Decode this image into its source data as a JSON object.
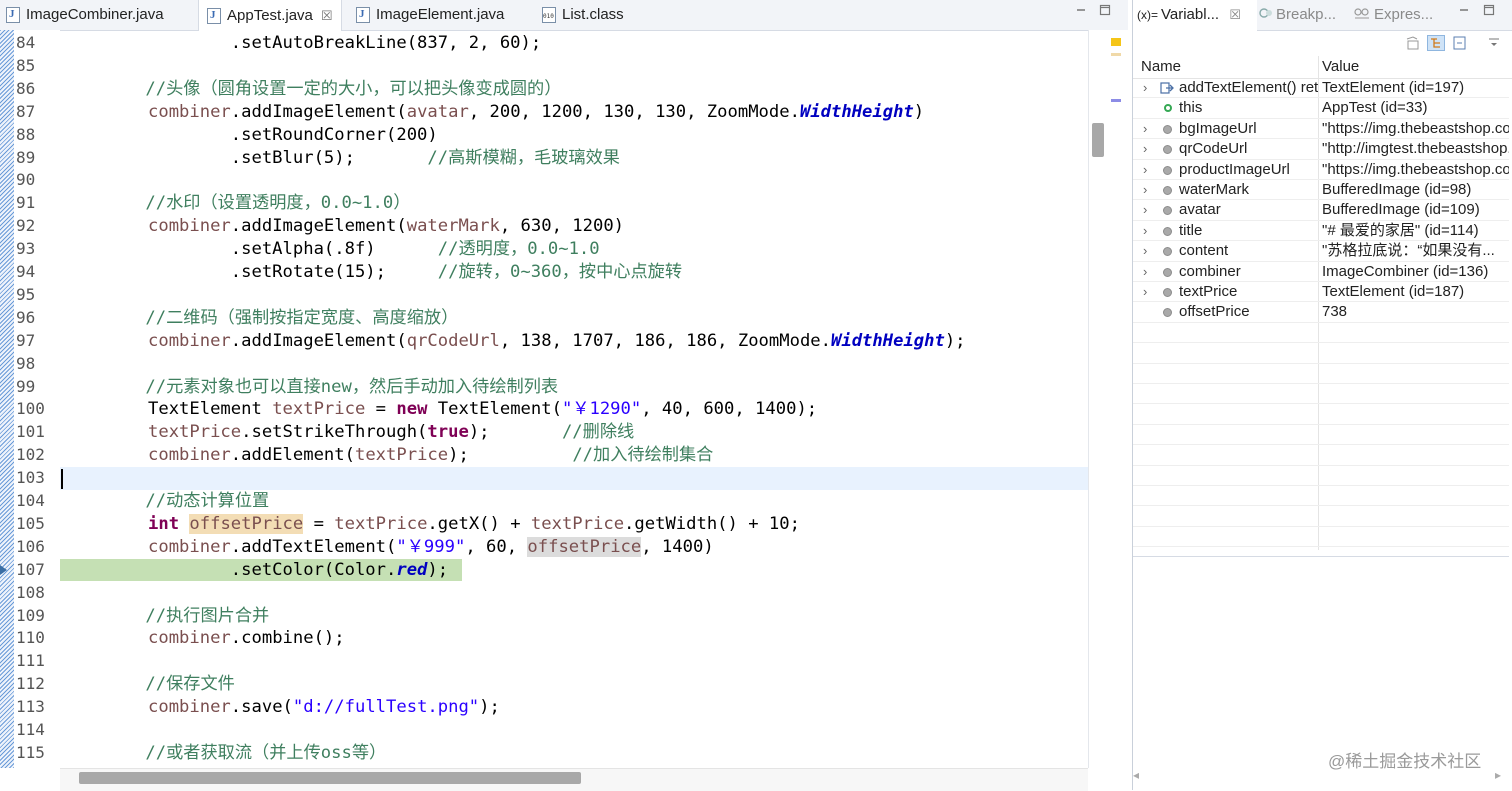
{
  "editor": {
    "tabs": [
      {
        "label": "ImageCombiner.java",
        "icon": "java-file-icon"
      },
      {
        "label": "AppTest.java",
        "icon": "java-file-icon",
        "active": true,
        "close": "☒"
      },
      {
        "label": "ImageElement.java",
        "icon": "java-file-icon"
      },
      {
        "label": "List.class",
        "icon": "class-file-icon"
      }
    ],
    "line_numbers": [
      "84",
      "85",
      "86",
      "87",
      "88",
      "89",
      "90",
      "91",
      "92",
      "93",
      "94",
      "95",
      "96",
      "97",
      "98",
      "99",
      "100",
      "101",
      "102",
      "103",
      "104",
      "105",
      "106",
      "107",
      "108",
      "109",
      "110",
      "111",
      "112",
      "113",
      "114",
      "115"
    ],
    "current_line": "103",
    "debug_line": "107",
    "colors": {
      "comment": "#3f7f5f",
      "field": "#7a4f4f",
      "keyword": "#7f0055",
      "string": "#2a00ff",
      "enum": "#0000c0",
      "current_line": "#e8f2fe",
      "debug_line": "#c5e0b4"
    },
    "code": {
      "l84": {
        "a": "        .setAutoBreakLine(837, 2, 60);"
      },
      "l86": {
        "c": "    //头像（圆角设置一定的大小，可以把头像变成圆的）"
      },
      "l87": {
        "f1": "combiner",
        "a": ".addImageElement(",
        "f2": "avatar",
        "b": ", 200, 1200, 130, 130, ZoomMode.",
        "e": "WidthHeight",
        "z": ")"
      },
      "l88": {
        "a": "        .setRoundCorner(200)"
      },
      "l89": {
        "a": "        .setBlur(5);       ",
        "c": "//高斯模糊，毛玻璃效果"
      },
      "l91": {
        "c": "    //水印（设置透明度，0.0~1.0）"
      },
      "l92": {
        "f1": "combiner",
        "a": ".addImageElement(",
        "f2": "waterMark",
        "b": ", 630, 1200)"
      },
      "l93": {
        "a": "        .setAlpha(.8f)      ",
        "c": "//透明度，0.0~1.0"
      },
      "l94": {
        "a": "        .setRotate(15);     ",
        "c": "//旋转，0~360，按中心点旋转"
      },
      "l96": {
        "c": "    //二维码（强制按指定宽度、高度缩放）"
      },
      "l97": {
        "f1": "combiner",
        "a": ".addImageElement(",
        "f2": "qrCodeUrl",
        "b": ", 138, 1707, 186, 186, ZoomMode.",
        "e": "WidthHeight",
        "z": ");"
      },
      "l99": {
        "c": "    //元素对象也可以直接new，然后手动加入待绘制列表"
      },
      "l100": {
        "a": "TextElement ",
        "f1": "textPrice",
        "b": " = ",
        "k": "new",
        "d": " TextElement(",
        "s": "\"￥1290\"",
        "z": ", 40, 600, 1400);"
      },
      "l101": {
        "f1": "textPrice",
        "a": ".setStrikeThrough(",
        "k": "true",
        "b": ");       ",
        "c": "//删除线"
      },
      "l102": {
        "f1": "combiner",
        "a": ".addElement(",
        "f2": "textPrice",
        "b": ");          ",
        "c": "//加入待绘制集合"
      },
      "l104": {
        "c": "    //动态计算位置"
      },
      "l105": {
        "k": "int",
        "h": "offsetPrice",
        "a": " = ",
        "f1": "textPrice",
        "b": ".getX() + ",
        "f2": "textPrice",
        "z": ".getWidth() + 10;"
      },
      "l106": {
        "f1": "combiner",
        "a": ".addTextElement(",
        "s": "\"￥999\"",
        "b": ", 60, ",
        "o": "offsetPrice",
        "z": ", 1400)"
      },
      "l107": {
        "a": "        .setColor(Color.",
        "e": "red",
        "z": ");"
      },
      "l109": {
        "c": "    //执行图片合并"
      },
      "l110": {
        "f1": "combiner",
        "a": ".combine();"
      },
      "l112": {
        "c": "    //保存文件"
      },
      "l113": {
        "f1": "combiner",
        "a": ".save(",
        "s": "\"d://fullTest.png\"",
        "z": ");"
      },
      "l115": {
        "c": "    //或者获取流（并上传oss等）"
      }
    }
  },
  "variables": {
    "tabs": [
      {
        "label": "Variabl...",
        "icon": "(x)=",
        "active": true,
        "close": "☒"
      },
      {
        "label": "Breakp...",
        "icon": "breakpoint-icon"
      },
      {
        "label": "Expres...",
        "icon": "expressions-icon"
      }
    ],
    "columns": {
      "name": "Name",
      "value": "Value"
    },
    "rows": [
      {
        "name": "addTextElement() returned",
        "value": "TextElement  (id=197)",
        "expand": "›",
        "icon": "return-value-icon"
      },
      {
        "name": "this",
        "value": "AppTest  (id=33)",
        "expand": "",
        "icon": "local-var-green-icon"
      },
      {
        "name": "bgImageUrl",
        "value": "\"https://img.thebeastshop.com\"",
        "expand": "›",
        "icon": "local-var-icon"
      },
      {
        "name": "qrCodeUrl",
        "value": "\"http://imgtest.thebeastshop.com\"",
        "expand": "›",
        "icon": "local-var-icon"
      },
      {
        "name": "productImageUrl",
        "value": "\"https://img.thebeastshop.com\"",
        "expand": "›",
        "icon": "local-var-icon"
      },
      {
        "name": "waterMark",
        "value": "BufferedImage  (id=98)",
        "expand": "›",
        "icon": "local-var-icon"
      },
      {
        "name": "avatar",
        "value": "BufferedImage  (id=109)",
        "expand": "›",
        "icon": "local-var-icon"
      },
      {
        "name": "title",
        "value": "\"# 最爱的家居\" (id=114)",
        "expand": "›",
        "icon": "local-var-icon"
      },
      {
        "name": "content",
        "value": "\"苏格拉底说：“如果没有...",
        "expand": "›",
        "icon": "local-var-icon"
      },
      {
        "name": "combiner",
        "value": "ImageCombiner  (id=136)",
        "expand": "›",
        "icon": "local-var-icon"
      },
      {
        "name": "textPrice",
        "value": "TextElement  (id=187)",
        "expand": "›",
        "icon": "local-var-icon"
      },
      {
        "name": "offsetPrice",
        "value": "738",
        "expand": "",
        "icon": "local-var-icon"
      }
    ],
    "watermark": "@稀土掘金技术社区"
  }
}
